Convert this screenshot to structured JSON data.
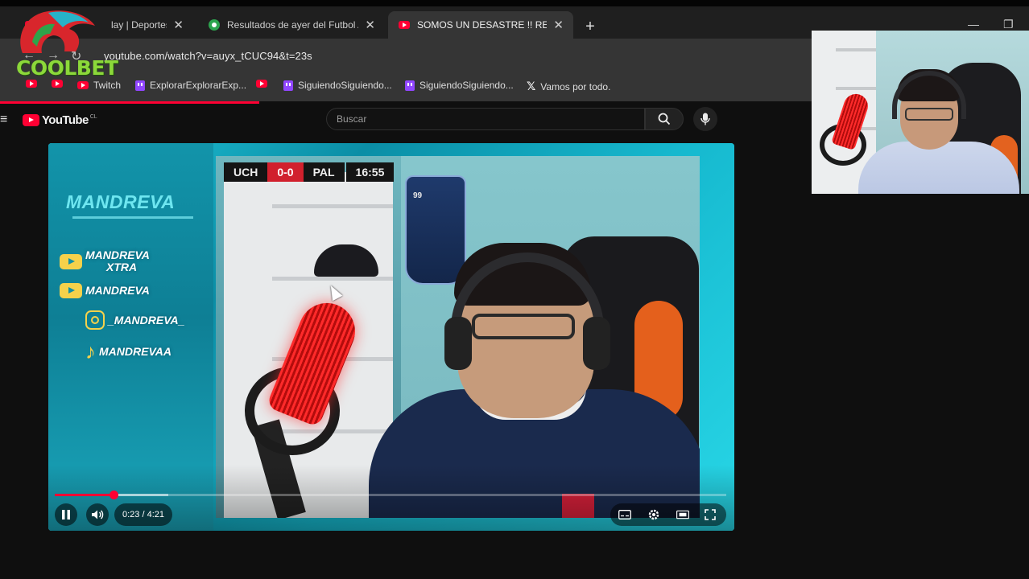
{
  "browser": {
    "tabs": [
      {
        "label": "lay | Deportes U",
        "icon": "youtube-favicon",
        "active": false
      },
      {
        "label": "Resultados de ayer del Futbol A",
        "icon": "soccer-favicon",
        "active": false
      },
      {
        "label": "SOMOS UN DESASTRE !! RE",
        "icon": "youtube-favicon",
        "active": true
      }
    ],
    "url": "youtube.com/watch?v=auyx_tCUC94&t=23s",
    "bookmarks": [
      {
        "label": "",
        "icon": "youtube-favicon"
      },
      {
        "label": "",
        "icon": "youtube-favicon"
      },
      {
        "label": "Twitch",
        "icon": "youtube-favicon"
      },
      {
        "label": "ExplorarExplorarExp...",
        "icon": "twitch-favicon"
      },
      {
        "label": "",
        "icon": "youtube-favicon"
      },
      {
        "label": "SiguiendoSiguiendo...",
        "icon": "twitch-favicon"
      },
      {
        "label": "SiguiendoSiguiendo...",
        "icon": "twitch-favicon"
      },
      {
        "label": "Vamos por todo.",
        "icon": "x-favicon"
      }
    ]
  },
  "overlay_logo": {
    "text": "COOLBET"
  },
  "youtube": {
    "logo_text": "YouTube",
    "region": "CL",
    "search_placeholder": "Buscar"
  },
  "player": {
    "current_time": "0:23",
    "duration": "4:21",
    "time_display": "0:23 / 4:21",
    "played_fraction": 0.088,
    "buffered_fraction": 0.169
  },
  "video_content": {
    "channel_name": "MANDREVA",
    "socials": [
      {
        "platform": "youtube",
        "label_line1": "MANDREVA",
        "label_line2": "XTRA"
      },
      {
        "platform": "youtube",
        "label_line1": "MANDREVA",
        "label_line2": ""
      },
      {
        "platform": "instagram",
        "label_line1": "_MANDREVA_",
        "label_line2": ""
      },
      {
        "platform": "tiktok",
        "label_line1": "MANDREVAA",
        "label_line2": ""
      }
    ],
    "scoreboard": {
      "home": "UCH",
      "score": "0-0",
      "away": "PAL",
      "clock": "16:55"
    },
    "card_rating": "99"
  },
  "colors": {
    "youtube_red": "#ff0033",
    "frame_cyan": "#1bb5c9",
    "social_yellow": "#f5d14b",
    "score_red": "#d1202d"
  }
}
